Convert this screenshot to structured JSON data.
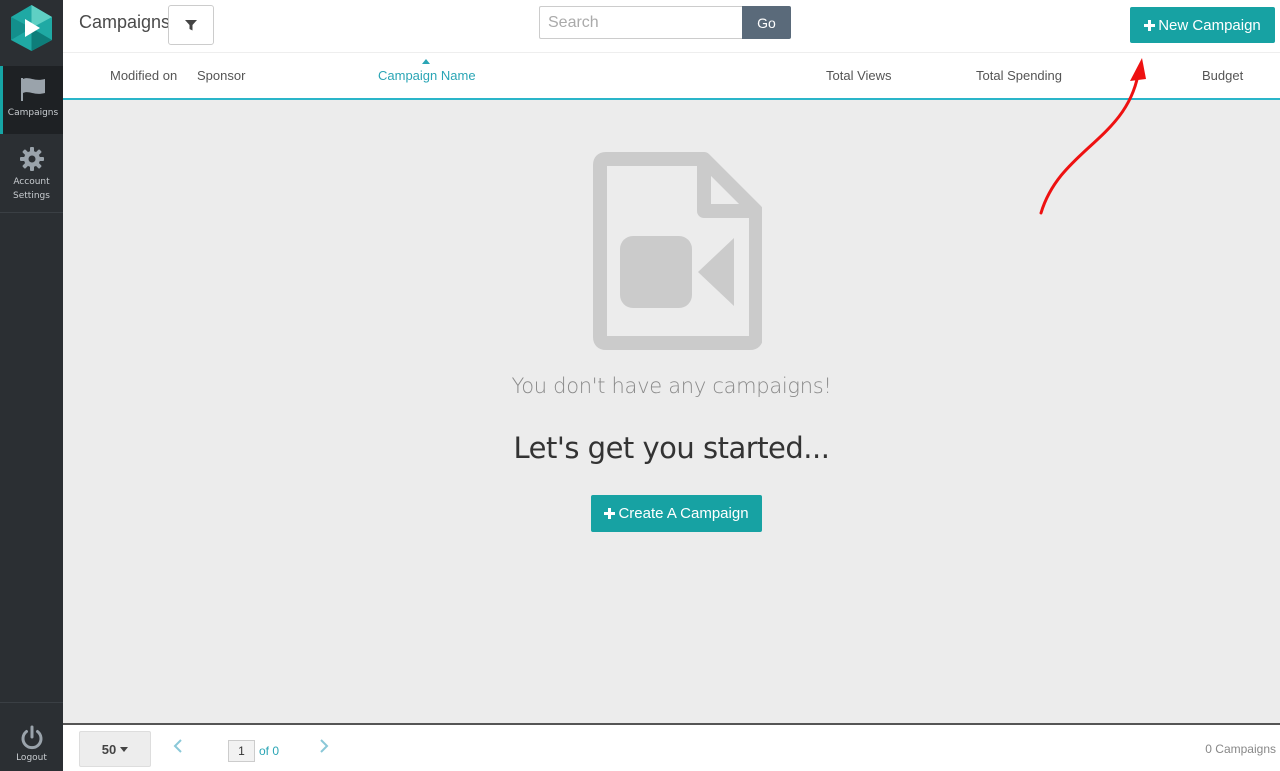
{
  "app": {
    "brand_color": "#17a2a3",
    "sidebar_bg": "#2b2f33"
  },
  "sidebar": {
    "items": [
      {
        "label": "Campaigns",
        "icon": "flag-icon",
        "active": true
      },
      {
        "label": "Account\nSettings",
        "icon": "gear-icon",
        "active": false
      }
    ],
    "logout_label": "Logout"
  },
  "header": {
    "title": "Campaigns",
    "search_placeholder": "Search",
    "go_label": "Go",
    "new_campaign_label": "New Campaign"
  },
  "columns": [
    {
      "label": "Modified on"
    },
    {
      "label": "Sponsor"
    },
    {
      "label": "Campaign Name",
      "sorted": "asc"
    },
    {
      "label": "Total Views"
    },
    {
      "label": "Total Spending"
    },
    {
      "label": "Budget"
    }
  ],
  "empty_state": {
    "icon": "video-file-icon",
    "message": "You don't have any campaigns!",
    "cta_heading": "Let's get you started...",
    "create_label": "Create A Campaign"
  },
  "annotation": {
    "arrow_color": "#ee1111"
  },
  "footer": {
    "per_page": "50",
    "page_value": "1",
    "page_of": "of 0",
    "count_text": "0 Campaigns"
  }
}
